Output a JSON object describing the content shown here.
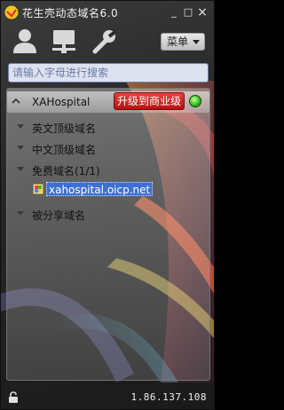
{
  "window": {
    "title": "花生壳动态域名6.0",
    "controls": {
      "minimize": "_",
      "maximize": "□",
      "close": "×"
    }
  },
  "toolbar": {
    "icons": [
      "user-icon",
      "server-icon",
      "wrench-icon"
    ],
    "menu_label": "菜单"
  },
  "search": {
    "placeholder": "请输入字母进行搜索",
    "value": ""
  },
  "account": {
    "name": "XAHospital",
    "upgrade_label": "升级到商业级",
    "status_color": "#35c21b"
  },
  "tree": {
    "groups": [
      {
        "label": "英文顶级域名"
      },
      {
        "label": "中文顶级域名"
      },
      {
        "label": "免费域名(1/1)",
        "items": [
          {
            "domain": "xahospital.oicp.net"
          }
        ]
      },
      {
        "label": "被分享域名"
      }
    ]
  },
  "statusbar": {
    "ip": "1.86.137.108"
  },
  "colors": {
    "upgrade": "#d42020",
    "selection": "#3d6fd6",
    "online": "#35c21b"
  }
}
